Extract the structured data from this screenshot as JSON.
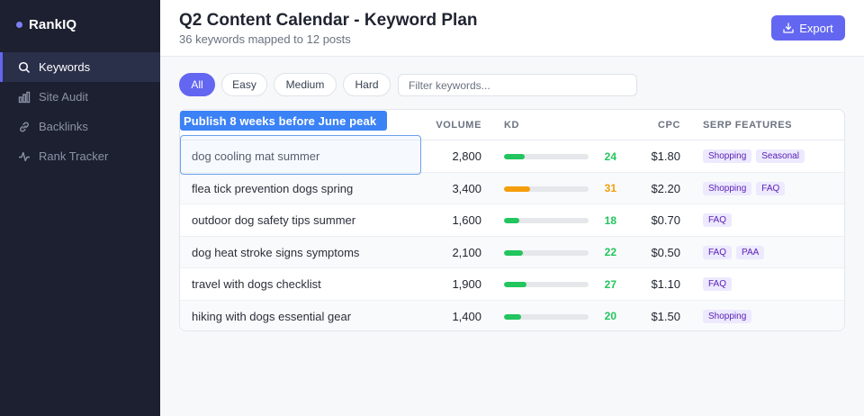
{
  "app": {
    "brand": "RankIQ"
  },
  "sidebar": {
    "items": [
      {
        "label": "Keywords",
        "icon": "search-icon",
        "active": true
      },
      {
        "label": "Site Audit",
        "icon": "bar-chart-icon",
        "active": false
      },
      {
        "label": "Backlinks",
        "icon": "link-icon",
        "active": false
      },
      {
        "label": "Rank Tracker",
        "icon": "activity-icon",
        "active": false
      }
    ]
  },
  "header": {
    "title": "Q2 Content Calendar - Keyword Plan",
    "subtitle": "36 keywords mapped to 12 posts",
    "export_label": "Export"
  },
  "filters": {
    "chips": [
      "All",
      "Easy",
      "Medium",
      "Hard"
    ],
    "active": "All",
    "search_placeholder": "Filter keywords..."
  },
  "callout": {
    "text": "Publish 8 weeks before June peak"
  },
  "table": {
    "columns": {
      "volume": "VOLUME",
      "kd": "KD",
      "cpc": "CPC",
      "serp": "SERP FEATURES"
    },
    "rows": [
      {
        "keyword": "dog cooling mat summer",
        "volume": "2,800",
        "kd": 24,
        "kd_text": "24",
        "cpc": "$1.80",
        "serp": [
          "Shopping",
          "Seasonal"
        ]
      },
      {
        "keyword": "flea tick prevention dogs spring",
        "volume": "3,400",
        "kd": 31,
        "kd_text": "31",
        "cpc": "$2.20",
        "serp": [
          "Shopping",
          "FAQ"
        ]
      },
      {
        "keyword": "outdoor dog safety tips summer",
        "volume": "1,600",
        "kd": 18,
        "kd_text": "18",
        "cpc": "$0.70",
        "serp": [
          "FAQ"
        ]
      },
      {
        "keyword": "dog heat stroke signs symptoms",
        "volume": "2,100",
        "kd": 22,
        "kd_text": "22",
        "cpc": "$0.50",
        "serp": [
          "FAQ",
          "PAA"
        ]
      },
      {
        "keyword": "travel with dogs checklist",
        "volume": "1,900",
        "kd": 27,
        "kd_text": "27",
        "cpc": "$1.10",
        "serp": [
          "FAQ"
        ]
      },
      {
        "keyword": "hiking with dogs essential gear",
        "volume": "1,400",
        "kd": 20,
        "kd_text": "20",
        "cpc": "$1.50",
        "serp": [
          "Shopping"
        ]
      }
    ]
  },
  "colors": {
    "accent": "#6366f1",
    "kd_easy": "#22c55e",
    "kd_medium": "#f59e0b",
    "callout": "#3b82f6"
  }
}
